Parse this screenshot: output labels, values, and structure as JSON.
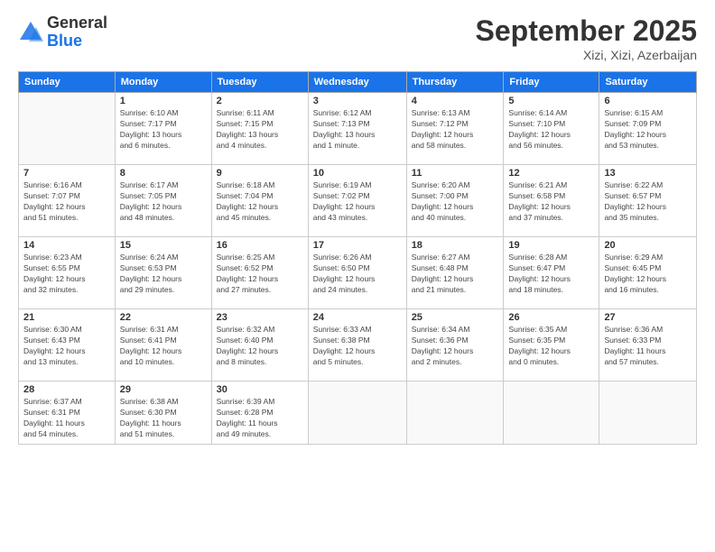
{
  "logo": {
    "general": "General",
    "blue": "Blue"
  },
  "title": "September 2025",
  "location": "Xizi, Xizi, Azerbaijan",
  "weekdays": [
    "Sunday",
    "Monday",
    "Tuesday",
    "Wednesday",
    "Thursday",
    "Friday",
    "Saturday"
  ],
  "weeks": [
    [
      {
        "day": "",
        "info": ""
      },
      {
        "day": "1",
        "info": "Sunrise: 6:10 AM\nSunset: 7:17 PM\nDaylight: 13 hours\nand 6 minutes."
      },
      {
        "day": "2",
        "info": "Sunrise: 6:11 AM\nSunset: 7:15 PM\nDaylight: 13 hours\nand 4 minutes."
      },
      {
        "day": "3",
        "info": "Sunrise: 6:12 AM\nSunset: 7:13 PM\nDaylight: 13 hours\nand 1 minute."
      },
      {
        "day": "4",
        "info": "Sunrise: 6:13 AM\nSunset: 7:12 PM\nDaylight: 12 hours\nand 58 minutes."
      },
      {
        "day": "5",
        "info": "Sunrise: 6:14 AM\nSunset: 7:10 PM\nDaylight: 12 hours\nand 56 minutes."
      },
      {
        "day": "6",
        "info": "Sunrise: 6:15 AM\nSunset: 7:09 PM\nDaylight: 12 hours\nand 53 minutes."
      }
    ],
    [
      {
        "day": "7",
        "info": "Sunrise: 6:16 AM\nSunset: 7:07 PM\nDaylight: 12 hours\nand 51 minutes."
      },
      {
        "day": "8",
        "info": "Sunrise: 6:17 AM\nSunset: 7:05 PM\nDaylight: 12 hours\nand 48 minutes."
      },
      {
        "day": "9",
        "info": "Sunrise: 6:18 AM\nSunset: 7:04 PM\nDaylight: 12 hours\nand 45 minutes."
      },
      {
        "day": "10",
        "info": "Sunrise: 6:19 AM\nSunset: 7:02 PM\nDaylight: 12 hours\nand 43 minutes."
      },
      {
        "day": "11",
        "info": "Sunrise: 6:20 AM\nSunset: 7:00 PM\nDaylight: 12 hours\nand 40 minutes."
      },
      {
        "day": "12",
        "info": "Sunrise: 6:21 AM\nSunset: 6:58 PM\nDaylight: 12 hours\nand 37 minutes."
      },
      {
        "day": "13",
        "info": "Sunrise: 6:22 AM\nSunset: 6:57 PM\nDaylight: 12 hours\nand 35 minutes."
      }
    ],
    [
      {
        "day": "14",
        "info": "Sunrise: 6:23 AM\nSunset: 6:55 PM\nDaylight: 12 hours\nand 32 minutes."
      },
      {
        "day": "15",
        "info": "Sunrise: 6:24 AM\nSunset: 6:53 PM\nDaylight: 12 hours\nand 29 minutes."
      },
      {
        "day": "16",
        "info": "Sunrise: 6:25 AM\nSunset: 6:52 PM\nDaylight: 12 hours\nand 27 minutes."
      },
      {
        "day": "17",
        "info": "Sunrise: 6:26 AM\nSunset: 6:50 PM\nDaylight: 12 hours\nand 24 minutes."
      },
      {
        "day": "18",
        "info": "Sunrise: 6:27 AM\nSunset: 6:48 PM\nDaylight: 12 hours\nand 21 minutes."
      },
      {
        "day": "19",
        "info": "Sunrise: 6:28 AM\nSunset: 6:47 PM\nDaylight: 12 hours\nand 18 minutes."
      },
      {
        "day": "20",
        "info": "Sunrise: 6:29 AM\nSunset: 6:45 PM\nDaylight: 12 hours\nand 16 minutes."
      }
    ],
    [
      {
        "day": "21",
        "info": "Sunrise: 6:30 AM\nSunset: 6:43 PM\nDaylight: 12 hours\nand 13 minutes."
      },
      {
        "day": "22",
        "info": "Sunrise: 6:31 AM\nSunset: 6:41 PM\nDaylight: 12 hours\nand 10 minutes."
      },
      {
        "day": "23",
        "info": "Sunrise: 6:32 AM\nSunset: 6:40 PM\nDaylight: 12 hours\nand 8 minutes."
      },
      {
        "day": "24",
        "info": "Sunrise: 6:33 AM\nSunset: 6:38 PM\nDaylight: 12 hours\nand 5 minutes."
      },
      {
        "day": "25",
        "info": "Sunrise: 6:34 AM\nSunset: 6:36 PM\nDaylight: 12 hours\nand 2 minutes."
      },
      {
        "day": "26",
        "info": "Sunrise: 6:35 AM\nSunset: 6:35 PM\nDaylight: 12 hours\nand 0 minutes."
      },
      {
        "day": "27",
        "info": "Sunrise: 6:36 AM\nSunset: 6:33 PM\nDaylight: 11 hours\nand 57 minutes."
      }
    ],
    [
      {
        "day": "28",
        "info": "Sunrise: 6:37 AM\nSunset: 6:31 PM\nDaylight: 11 hours\nand 54 minutes."
      },
      {
        "day": "29",
        "info": "Sunrise: 6:38 AM\nSunset: 6:30 PM\nDaylight: 11 hours\nand 51 minutes."
      },
      {
        "day": "30",
        "info": "Sunrise: 6:39 AM\nSunset: 6:28 PM\nDaylight: 11 hours\nand 49 minutes."
      },
      {
        "day": "",
        "info": ""
      },
      {
        "day": "",
        "info": ""
      },
      {
        "day": "",
        "info": ""
      },
      {
        "day": "",
        "info": ""
      }
    ]
  ]
}
